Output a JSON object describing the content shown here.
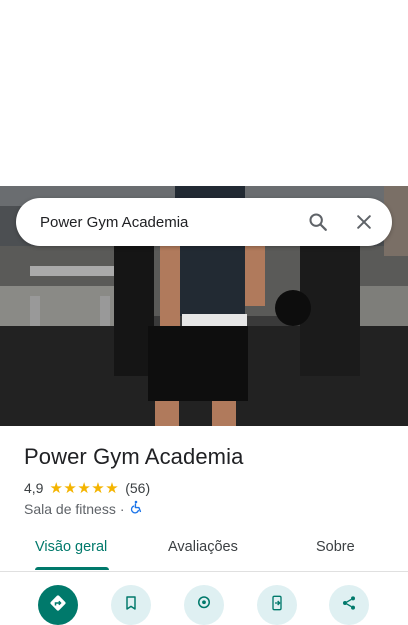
{
  "search": {
    "query": "Power Gym Academia"
  },
  "place": {
    "name": "Power Gym Academia",
    "rating": "4,9",
    "stars": "★★★★★",
    "review_count": "(56)",
    "category": "Sala de fitness",
    "separator": "·"
  },
  "tabs": [
    {
      "label": "Visão geral",
      "active": true
    },
    {
      "label": "Avaliações",
      "active": false
    },
    {
      "label": "Sobre",
      "active": false
    }
  ],
  "actions": [
    {
      "icon": "directions-icon"
    },
    {
      "icon": "bookmark-icon"
    },
    {
      "icon": "nearby-icon"
    },
    {
      "icon": "send-to-phone-icon"
    },
    {
      "icon": "share-icon"
    }
  ],
  "colors": {
    "accent": "#00796b",
    "star": "#f4b400",
    "action_bg": "#dff0f2"
  }
}
